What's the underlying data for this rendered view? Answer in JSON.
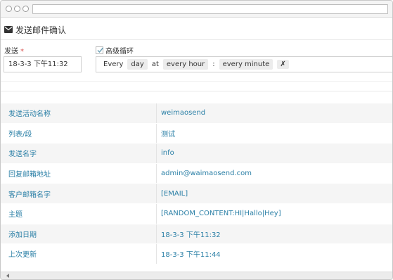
{
  "header": {
    "title": "发送邮件确认",
    "icon": "envelope-icon"
  },
  "form": {
    "send_label": "发送",
    "required_mark": "*",
    "send_datetime": "18-3-3 下午11:32",
    "advanced_label": "高级循环",
    "advanced_checked": true,
    "cron": {
      "every_label": "Every",
      "period": "day",
      "at_label": "at",
      "hour": "every hour",
      "separator": ":",
      "minute": "every minute",
      "clear_label": "✗"
    }
  },
  "details": [
    {
      "key": "发送活动名称",
      "value": "weimaosend"
    },
    {
      "key": "列表/段",
      "value": "测试"
    },
    {
      "key": "发送名字",
      "value": "info"
    },
    {
      "key": "回复邮箱地址",
      "value": "admin@waimaosend.com"
    },
    {
      "key": "客户邮箱名字",
      "value": "[EMAIL]"
    },
    {
      "key": "主题",
      "value": "[RANDOM_CONTENT:HI|Hallo|Hey]"
    },
    {
      "key": "添加日期",
      "value": "18-3-3 下午11:32"
    },
    {
      "key": "上次更新",
      "value": "18-3-3 下午11:44"
    }
  ],
  "colors": {
    "accent": "#2a7fa6",
    "required": "#d9534f",
    "row_alt": "#f5f5f5"
  }
}
